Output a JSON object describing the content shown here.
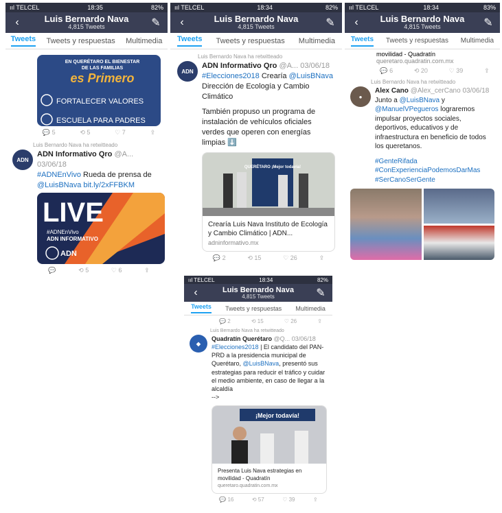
{
  "profile": {
    "name": "Luis Bernardo Nava",
    "tweet_count": "4,815 Tweets"
  },
  "tabs": [
    "Tweets",
    "Tweets y respuestas",
    "Multimedia"
  ],
  "panel1": {
    "status": {
      "carrier": "ııl TELCEL",
      "time": "18:35",
      "battery": "82%"
    },
    "banner": {
      "line1": "EN QUERÉTARO EL BIENESTAR",
      "line2": "DE LAS FAMILIAS",
      "line3": "es Primero",
      "item1": "FORTALECER VALORES",
      "item2": "ESCUELA PARA PADRES"
    },
    "actions1": [
      "5",
      "5",
      "7",
      ""
    ],
    "tweet": {
      "rt": "Luis Bernardo Nava ha retwitteado",
      "author": "ADN Informativo Qro",
      "handle": "@A...",
      "date": "03/06/18",
      "text1": "#ADNEnVivo",
      "text2": " Rueda de prensa de",
      "text3": "@LuisBNava bit.ly/2xFFBKM",
      "live": "LIVE",
      "live_tag": "#ADNEnVivo",
      "live_brand": "ADN INFORMATIVO",
      "logo": "ADN"
    },
    "actions2": [
      "",
      "5",
      "6",
      ""
    ]
  },
  "panel2": {
    "status": {
      "carrier": "ııl TELCEL",
      "time": "18:34",
      "battery": "82%"
    },
    "tweet": {
      "rt": "Luis Bernardo Nava ha retwitteado",
      "author": "ADN Informativo Qro",
      "handle": "@A...",
      "date": "03/06/18",
      "hashtag": "#Elecciones2018",
      "text_a": " Crearía ",
      "mention": "@LuisBNava",
      "text_b": "Dirección de Ecología y Cambio Climático",
      "para2": "También propuso un programa de instalación de vehículos oficiales verdes que operen con energías limpias ⬇️",
      "sign": "QUERÉTARO ¡Mejor todavía!",
      "card_title": "Crearía Luis Nava Instituto de Ecología y Cambio Climático | ADN...",
      "card_domain": "adninformativo.mx"
    },
    "actions": [
      "2",
      "15",
      "26",
      ""
    ]
  },
  "panel3": {
    "status": {
      "carrier": "ııl TELCEL",
      "time": "18:34",
      "battery": "82%"
    },
    "actions_top": [
      "2",
      "15",
      "26",
      ""
    ],
    "tweet": {
      "rt": "Luis Bernardo Nava ha retwitteado",
      "author": "Quadratín Querétaro",
      "handle": "@Q...",
      "date": "03/06/18",
      "hashtag": "#Elecciones2018",
      "text": " | El candidato del PAN-PRD a la presidencia municipal de Querétaro, ",
      "mention": "@LuisBNava",
      "text2": ", presentó sus estrategias para reducir el tráfico y cuidar el medio ambiente, en caso de llegar a la alcaldía",
      "arrow": "-->",
      "sign": "¡Mejor todavía!",
      "card_title": "Presenta Luis Nava estrategias en movilidad - Quadratín",
      "card_domain": "queretaro.quadratin.com.mx"
    },
    "actions": [
      "16",
      "57",
      "39",
      ""
    ]
  },
  "panel4": {
    "status": {
      "carrier": "ııl TELCEL",
      "time": "18:34",
      "battery": "83%"
    },
    "prev_card_title": "movilidad - Quadratín",
    "prev_card_domain": "queretaro.quadratin.com.mx",
    "actions_top": [
      "6",
      "20",
      "39",
      ""
    ],
    "tweet": {
      "rt": "Luis Bernardo Nava ha retwitteado",
      "author": "Alex Cano",
      "handle": "@Alex_cerCano",
      "date": "03/06/18",
      "text1": "Junto a ",
      "mention1": "@LuisBNava",
      "text2": " y ",
      "mention2": "@ManuelVPegueros",
      "text3": " lograremos impulsar proyectos sociales, deportivos, educativos y de infraestructura en beneficio de todos los queretanos.",
      "tag1": "#GenteRifada",
      "tag2": "#ConExperienciaPodemosDarMas",
      "tag3": "#SerCanoSerGente"
    }
  }
}
